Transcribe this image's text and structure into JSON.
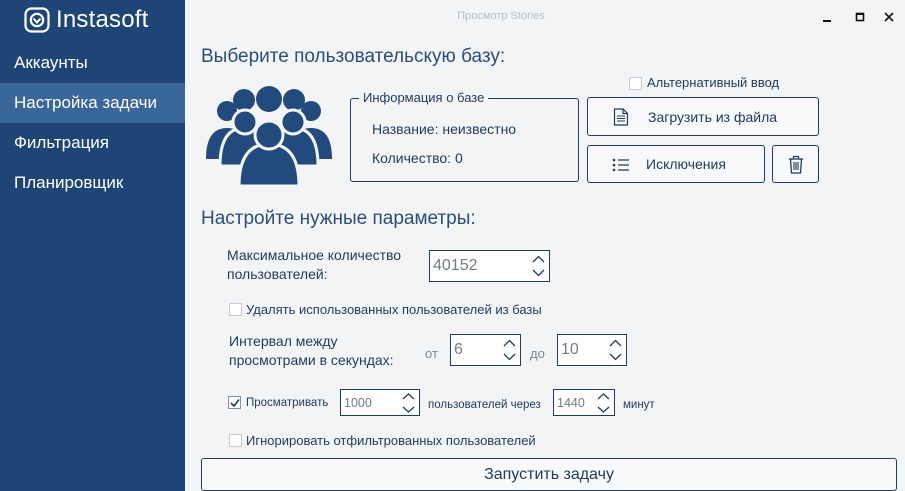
{
  "app": {
    "logo_text": "Instasoft",
    "window_title": "Просмотр Stories"
  },
  "sidebar": {
    "items": [
      {
        "label": "Аккаунты",
        "active": false
      },
      {
        "label": "Настройка задачи",
        "active": true
      },
      {
        "label": "Фильтрация",
        "active": false
      },
      {
        "label": "Планировщик",
        "active": false
      }
    ]
  },
  "base_section": {
    "heading": "Выберите пользовательскую базу:",
    "alternative_input": {
      "label": "Альтернативный ввод",
      "checked": false
    },
    "info": {
      "legend": "Информация о базе",
      "name_line": "Название: неизвестно",
      "count_line": "Количество: 0"
    },
    "load_button": "Загрузить из файла",
    "exclusions_button": "Исключения"
  },
  "params_section": {
    "heading": "Настройте нужные параметры:",
    "max_users": {
      "label_line1": "Максимальное количество",
      "label_line2": "пользователей:",
      "value": "40152"
    },
    "delete_used": {
      "label": "Удалять использованных пользователей из базы",
      "checked": false
    },
    "interval": {
      "label_line1": "Интервал между",
      "label_line2": "просмотрами в секундах:",
      "from_label": "от",
      "from_value": "6",
      "to_label": "до",
      "to_value": "10"
    },
    "view_every": {
      "label": "Просматривать",
      "checked": true,
      "count_value": "1000",
      "users_after": "пользователей через",
      "minutes_value": "1440",
      "minutes_label": "минут"
    },
    "ignore_filtered": {
      "label": "Игнорировать отфильтрованных пользователей",
      "checked": false
    }
  },
  "start_button": "Запустить задачу",
  "colors": {
    "sidebar": "#1e4576",
    "sidebar_active": "#3a6699",
    "accent": "#1e3d64",
    "background": "#f3f4f6"
  }
}
